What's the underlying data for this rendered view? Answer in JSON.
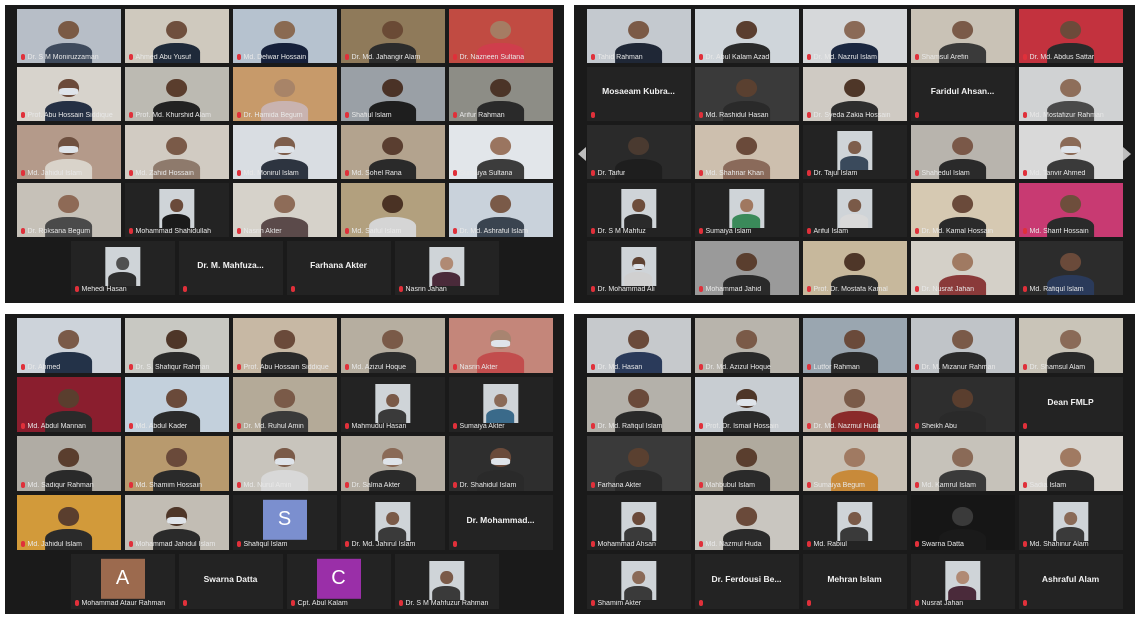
{
  "colors": {
    "active_border": "#c9d94a",
    "mic_muted": "#e0303a",
    "tile_bg": "#232323",
    "panel_bg": "#1a1a1a"
  },
  "panels": [
    {
      "id": "top-left",
      "rows": [
        [
          {
            "name": "Dr. S M Moniruzzaman",
            "bg": "#b7bec7",
            "skin": "#7a5a45",
            "shirt": "#3e4a5c"
          },
          {
            "name": "Ahmed Abu Yusuf",
            "bg": "#cfc9be",
            "skin": "#6f4f3e",
            "shirt": "#1f2a3a"
          },
          {
            "name": "Md. Delwar Hossain",
            "bg": "#b6c2cf",
            "skin": "#8a6a52",
            "shirt": "#16203a"
          },
          {
            "name": "Dr. Md. Jahangir Alam",
            "bg": "#8f7a5a",
            "skin": "#6a4a35",
            "shirt": "#2c2c2c"
          },
          {
            "name": "Dr. Nazneen Sultana",
            "bg": "#c14b42",
            "skin": "#a57c63",
            "shirt": "#cf3e4c"
          }
        ],
        [
          {
            "name": "Prof. Abu Hossain Siddique",
            "bg": "#d7d3cc",
            "skin": "#6b4a3a",
            "shirt": "#253044",
            "mask": true
          },
          {
            "name": "Prof. Md. Khurshid Alam",
            "bg": "#bcbab2",
            "skin": "#5a3d2d",
            "shirt": "#222222",
            "active": true
          },
          {
            "name": "Dr. Hamida Begum",
            "bg": "#c79a6a",
            "skin": "#a88468",
            "shirt": "#c9b3b0"
          },
          {
            "name": "Shafiul Islam",
            "bg": "#9aa0a6",
            "skin": "#4a3226",
            "shirt": "#1e1e1e"
          },
          {
            "name": "Arifur Rahman",
            "bg": "#8d8d86",
            "skin": "#4b3427",
            "shirt": "#2a2a2a"
          }
        ],
        [
          {
            "name": "Md. Jahidul Islam",
            "bg": "#b49a8a",
            "skin": "#6e5040",
            "shirt": "#d9d3ca",
            "mask": true
          },
          {
            "name": "Md. Zahid Hossain",
            "bg": "#d1cbc2",
            "skin": "#7a5a48",
            "shirt": "#8e7a6c"
          },
          {
            "name": "Md. Monirul Islam",
            "bg": "#d9dde2",
            "skin": "#7e5e4c",
            "shirt": "#2d3440",
            "mask": true
          },
          {
            "name": "Md. Sohel Rana",
            "bg": "#b3a38e",
            "skin": "#5a3e30",
            "shirt": "#2a2a2a"
          },
          {
            "name": "Sumaiya Sultana",
            "bg": "#e2e6ea",
            "skin": "#9a7560",
            "shirt": "#3c3c3c"
          }
        ],
        [
          {
            "name": "Dr. Roksana Begum",
            "bg": "#c6c1b8",
            "skin": "#8e6a56",
            "shirt": "#4a4a4a"
          },
          {
            "name": "Mohammad Shahidullah",
            "bg": "#222222",
            "skin": "#6a4a3a",
            "shirt": "#1a1a1a",
            "small": true
          },
          {
            "name": "Nasrin Akter",
            "bg": "#d6d2ca",
            "skin": "#8e6c58",
            "shirt": "#5b4a4a"
          },
          {
            "name": "Md. Saiful Islam",
            "bg": "#b2a07e",
            "skin": "#4a3224",
            "shirt": "#d5d5d5"
          },
          {
            "name": "Dr. Md. Ashraful Islam",
            "bg": "#c9d2db",
            "skin": "#7a5a48",
            "shirt": "#3a4450"
          }
        ],
        [
          {
            "name": "Mehedi Hasan",
            "bg": "#1a1a1a",
            "skin": "#505050",
            "shirt": "#2e2e2e",
            "small": true
          },
          {
            "nick": "Dr. M. Mahfuza..."
          },
          {
            "nick": "Farhana Akter"
          },
          {
            "name": "Nasrin Jahan",
            "bg": "#222222",
            "skin": "#b08a74",
            "shirt": "#4a2a3a",
            "small": true
          }
        ]
      ]
    },
    {
      "id": "top-right",
      "rows": [
        [
          {
            "name": "Tahid Rahman",
            "bg": "#c4c9cf",
            "skin": "#7b5a47",
            "shirt": "#1f2736"
          },
          {
            "name": "Dr. Abul Kalam Azad",
            "bg": "#cfd5da",
            "skin": "#5a3e2f",
            "shirt": "#2a2a2a"
          },
          {
            "name": "Dr. Md. Nazrul Islam",
            "bg": "#d6d8da",
            "skin": "#8a6a57",
            "shirt": "#1b2740"
          },
          {
            "name": "Shamsul Arefin",
            "bg": "#c9c2b6",
            "skin": "#7a5a48",
            "shirt": "#3a3a3a",
            "active": true
          },
          {
            "name": "Dr. Md. Abdus Sattar",
            "bg": "#c3323e",
            "skin": "#6c4a3a",
            "shirt": "#2a2a2a"
          }
        ],
        [
          {
            "nick": "Mosaeam Kubra..."
          },
          {
            "name": "Md. Rashidul Hasan",
            "bg": "#3a3a3a",
            "skin": "#5a4030",
            "shirt": "#2a2a2a"
          },
          {
            "name": "Dr. Syeda Zakia Hossain",
            "bg": "#cfcac3",
            "skin": "#4e3628",
            "shirt": "#2e2e2e"
          },
          {
            "nick": "Faridul Ahsan..."
          },
          {
            "name": "Md. Mostafizur Rahman",
            "bg": "#d0d2d3",
            "skin": "#8e6e5a",
            "shirt": "#4a4a4a"
          }
        ],
        [
          {
            "name": "Dr. Taifur",
            "bg": "#2a2a2a",
            "skin": "#4a3a30",
            "shirt": "#1e1e1e"
          },
          {
            "name": "Md. Shahriar Khan",
            "bg": "#cdbfae",
            "skin": "#6a4a3a",
            "shirt": "#8a6a5a"
          },
          {
            "name": "Dr. Tajul Islam",
            "bg": "#1f1f1f",
            "skin": "#7e5e4c",
            "shirt": "#3a4a5c",
            "small": true
          },
          {
            "name": "Shahedul Islam",
            "bg": "#b8b4ad",
            "skin": "#7a5848",
            "shirt": "#2a2a2a"
          },
          {
            "name": "Md. Tanvir Ahmed",
            "bg": "#d9d9d9",
            "skin": "#8a6a57",
            "shirt": "#3a3a3a",
            "mask": true
          }
        ],
        [
          {
            "name": "Dr. S M Mahfuz",
            "bg": "#1f1f1f",
            "skin": "#6e4e3c",
            "shirt": "#2a2a2a",
            "small": true
          },
          {
            "name": "Sumaiya Islam",
            "bg": "#1f1f1f",
            "skin": "#a07860",
            "shirt": "#3a8a5a",
            "small": true
          },
          {
            "name": "Ariful Islam",
            "bg": "#1f1f1f",
            "skin": "#7a5a48",
            "shirt": "#d9d9d9",
            "small": true
          },
          {
            "name": "Dr. Md. Kamal Hossain",
            "bg": "#d6c9b2",
            "skin": "#6a4a3a",
            "shirt": "#2a2a2a"
          },
          {
            "name": "Md. Sharif Hossain",
            "bg": "#c83a72",
            "skin": "#6e4e3c",
            "shirt": "#2a2a2a"
          }
        ],
        [
          {
            "name": "Dr. Mohammad Ali",
            "bg": "#2a2a2a",
            "skin": "#5e4232",
            "shirt": "#d0d0d0",
            "small": true,
            "mask": true
          },
          {
            "name": "Mohammad Jahid",
            "bg": "#9a9a9a",
            "skin": "#5a3e2e",
            "shirt": "#2a2a2a"
          },
          {
            "name": "Prof. Dr. Mostafa Kamal",
            "bg": "#c7b89c",
            "skin": "#4e3628",
            "shirt": "#2a2a2a"
          },
          {
            "name": "Dr. Nusrat Jahan",
            "bg": "#d4d0c8",
            "skin": "#a07a62",
            "shirt": "#8a3a3a"
          },
          {
            "name": "Md. Rafiqul Islam",
            "bg": "#2c2c2c",
            "skin": "#6a4a3a",
            "shirt": "#2a3a5a"
          }
        ]
      ]
    },
    {
      "id": "bottom-left",
      "rows": [
        [
          {
            "name": "Dr. Ahmed",
            "bg": "#cdd3da",
            "skin": "#7a5a48",
            "shirt": "#233248"
          },
          {
            "name": "Dr. S. Shafiqur Rahman",
            "bg": "#c8c8c2",
            "skin": "#4e3628",
            "shirt": "#2a2a2a"
          },
          {
            "name": "Prof. Abu Hossain Siddique",
            "bg": "#c7b8a4",
            "skin": "#6a4a3a",
            "shirt": "#2a2a2a",
            "active": true
          },
          {
            "name": "Md. Azizul Hoque",
            "bg": "#b6aea0",
            "skin": "#7a5a48",
            "shirt": "#2e2e2e"
          },
          {
            "name": "Nasrin Akter",
            "bg": "#c4867a",
            "skin": "#a88470",
            "shirt": "#c24d4d",
            "mask": true
          }
        ],
        [
          {
            "name": "Md. Abdul Mannan",
            "bg": "#8a1e2e",
            "skin": "#5a3e2e",
            "shirt": "#2a2a2a"
          },
          {
            "name": "Md. Abdul Kader",
            "bg": "#c3d0dc",
            "skin": "#6a4a3a",
            "shirt": "#2a2a2a"
          },
          {
            "name": "Dr. Md. Ruhul Amin",
            "bg": "#b4aa98",
            "skin": "#7a5a48",
            "shirt": "#3a3a3a"
          },
          {
            "name": "Mahmudul Hasan",
            "bg": "#2a2a2a",
            "skin": "#7a5a48",
            "shirt": "#3a3a3a",
            "small": true
          },
          {
            "name": "Sumaiya Akter",
            "bg": "#2a2a2a",
            "skin": "#8a6a57",
            "shirt": "#3a6a8a",
            "small": true
          }
        ],
        [
          {
            "name": "Md. Sadiqur Rahman",
            "bg": "#b0aca4",
            "skin": "#5a3e2e",
            "shirt": "#2a2a2a"
          },
          {
            "name": "Md. Shamim Hossain",
            "bg": "#b89a6e",
            "skin": "#6a4a3a",
            "shirt": "#2a2a2a"
          },
          {
            "name": "Md. Nurul Amin",
            "bg": "#c8c4bc",
            "skin": "#7a5a48",
            "shirt": "#d8d8d8",
            "mask": true
          },
          {
            "name": "Dr. Salma Akter",
            "bg": "#b4ada2",
            "skin": "#8a6a57",
            "shirt": "#2a2a2a",
            "mask": true
          },
          {
            "name": "Dr. Shahidul Islam",
            "bg": "#2e2e2e",
            "skin": "#6a4a3a",
            "shirt": "#2a2a2a",
            "mask": true
          }
        ],
        [
          {
            "name": "Md. Jahidul Islam",
            "bg": "#d29a3a",
            "skin": "#5a3e2e",
            "shirt": "#2a2a2a"
          },
          {
            "name": "Mohammad Jahidul Islam",
            "bg": "#c2bdb4",
            "skin": "#4e3628",
            "shirt": "#2a2a2a",
            "mask": true
          },
          {
            "name": "Shafiqul Islam",
            "letter": "S",
            "lcolor": "#7b8fcf"
          },
          {
            "name": "Dr. Md. Jahirul Islam",
            "bg": "#2a2a2a",
            "skin": "#7a5a48",
            "shirt": "#3a3a3a",
            "small": true
          },
          {
            "nick": "Dr. Mohammad..."
          }
        ],
        [
          {
            "name": "Mohammad Ataur Rahman",
            "letter": "A",
            "lcolor": "#9c6a4e"
          },
          {
            "nick": "Swarna Datta"
          },
          {
            "name": "Cpt. Abul Kalam",
            "letter": "C",
            "lcolor": "#9a2fa8"
          },
          {
            "name": "Dr. S M Mahfuzur Rahman",
            "bg": "#2a2a2a",
            "skin": "#7a5a48",
            "shirt": "#3a3a3a",
            "small": true
          }
        ]
      ]
    },
    {
      "id": "bottom-right",
      "rows": [
        [
          {
            "name": "Dr. Md. Hasan",
            "bg": "#c6c9cc",
            "skin": "#6a4a3a",
            "shirt": "#2a3a5a"
          },
          {
            "name": "Dr. Md. Azizul Hoque",
            "bg": "#b8b4ac",
            "skin": "#7a5a48",
            "shirt": "#2a2a2a"
          },
          {
            "name": "Lutfor Rahman",
            "bg": "#9aa6b0",
            "skin": "#6a4a3a",
            "shirt": "#2a2a2a"
          },
          {
            "name": "Dr. M. Mizanur Rahman",
            "bg": "#c0c4c8",
            "skin": "#7a5a48",
            "shirt": "#2a2a2a"
          },
          {
            "name": "Dr. Shamsul Alam",
            "bg": "#c9c4b8",
            "skin": "#8a6a57",
            "shirt": "#2a2a2a"
          }
        ],
        [
          {
            "name": "Dr. Md. Rafiqul Islam",
            "bg": "#b4b1aa",
            "skin": "#6a4a3a",
            "shirt": "#2a2a2a"
          },
          {
            "name": "Prof. Dr. Ismail Hossain",
            "bg": "#c8cdd2",
            "skin": "#4e3628",
            "shirt": "#2a2a2a",
            "active": true,
            "mask": true
          },
          {
            "name": "Dr. Md. Nazmul Huda",
            "bg": "#c0b2a6",
            "skin": "#7a5a48",
            "shirt": "#8a2a2a"
          },
          {
            "name": "Sheikh Abu",
            "bg": "#2e2e2e",
            "skin": "#5a3e2e",
            "shirt": "#2a2a2a"
          },
          {
            "nick": "Dean FMLP"
          }
        ],
        [
          {
            "name": "Farhana Akter",
            "bg": "#3a3a3a",
            "skin": "#5a4030",
            "shirt": "#2a2a2a"
          },
          {
            "name": "Mahbubul Islam",
            "bg": "#b0aa9e",
            "skin": "#5a3e2e",
            "shirt": "#2a2a2a"
          },
          {
            "name": "Sumaiya Begum",
            "bg": "#c8c0b4",
            "skin": "#a07a62",
            "shirt": "#c88a3a"
          },
          {
            "name": "Md. Kamrul Islam",
            "bg": "#c6c2ba",
            "skin": "#8a6a57",
            "shirt": "#3a3a3a"
          },
          {
            "name": "Sadia Islam",
            "bg": "#d8d4ce",
            "skin": "#a07a62",
            "shirt": "#2a2a2a"
          }
        ],
        [
          {
            "name": "Mohammad Ahsan",
            "bg": "#2a2a2a",
            "skin": "#6a4a3a",
            "shirt": "#3a3a3a",
            "small": true
          },
          {
            "name": "Md. Nazmul Huda",
            "bg": "#c9c6c0",
            "skin": "#6a4a3a",
            "shirt": "#2a2a2a"
          },
          {
            "name": "Md. Rabiul",
            "bg": "#2a2a2a",
            "skin": "#7a5a48",
            "shirt": "#3a3a3a",
            "small": true
          },
          {
            "name": "Swarna Datta",
            "bg": "#161616",
            "skin": "#3a3a3a",
            "shirt": "#1a1a1a"
          },
          {
            "name": "Md. Shahinur Alam",
            "bg": "#2a2a2a",
            "skin": "#8a6a57",
            "shirt": "#3a3a3a",
            "small": true
          }
        ],
        [
          {
            "name": "Shamim Akter",
            "bg": "#2a2a2a",
            "skin": "#8a6a57",
            "shirt": "#3a3a3a",
            "small": true
          },
          {
            "nick": "Dr. Ferdousi Be..."
          },
          {
            "nick": "Mehran Islam"
          },
          {
            "name": "Nusrat Jahan",
            "bg": "#2a2a2a",
            "skin": "#b08a74",
            "shirt": "#4a2a3a",
            "small": true
          },
          {
            "nick": "Ashraful Alam"
          }
        ]
      ]
    }
  ]
}
